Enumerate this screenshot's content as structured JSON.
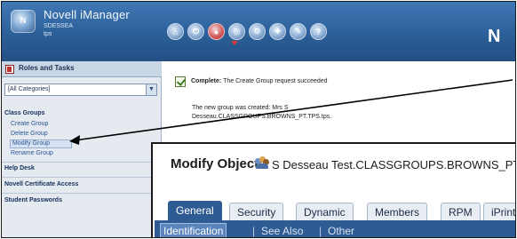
{
  "app": {
    "title": "Novell iManager",
    "tree": "SDESSEA",
    "user": "tps",
    "logo_text": "N",
    "brand_letter": "N"
  },
  "toolbar": {
    "buttons": [
      {
        "name": "home-icon",
        "glyph": "⌂"
      },
      {
        "name": "exit-icon",
        "glyph": "⏻"
      },
      {
        "name": "roles-and-tasks-icon",
        "glyph": "●",
        "active": true
      },
      {
        "name": "view-objects-icon",
        "glyph": "◎"
      },
      {
        "name": "configure-icon",
        "glyph": "⚙"
      },
      {
        "name": "favorites-icon",
        "glyph": "✚"
      },
      {
        "name": "preferences-icon",
        "glyph": "✎"
      },
      {
        "name": "help-icon",
        "glyph": "?"
      }
    ]
  },
  "sidebar": {
    "header": "Roles and Tasks",
    "category_value": "[All Categories]",
    "sections": [
      {
        "label": "Class Groups",
        "items": [
          "Create Group",
          "Delete Group",
          "Modify Group",
          "Rename Group"
        ],
        "selected": "Modify Group"
      },
      {
        "label": "Help Desk"
      },
      {
        "label": "Novell Certificate Access"
      },
      {
        "label": "Student Passwords"
      }
    ]
  },
  "main": {
    "status_label": "Complete:",
    "status_message": "The Create Group request succeeded",
    "created_message": "The new group was created: Mrs S Desseau.CLASSGROUPS.BROWNS_PT.TPS.tps."
  },
  "modify_object": {
    "title": "Modify Object:",
    "object_name": "S Desseau Test.CLASSGROUPS.BROWNS_PT.TPS.tps",
    "tabs": [
      "General",
      "Security",
      "Dynamic",
      "Members",
      "RPM",
      "iPrint"
    ],
    "active_tab": "General",
    "subtabs": [
      "Identification",
      "See Also",
      "Other"
    ],
    "active_subtab": "Identification"
  },
  "colors": {
    "header_blue": "#2c5f98",
    "tab_active": "#2f5b93",
    "link_blue": "#2a5594",
    "arrow": "#000000"
  }
}
